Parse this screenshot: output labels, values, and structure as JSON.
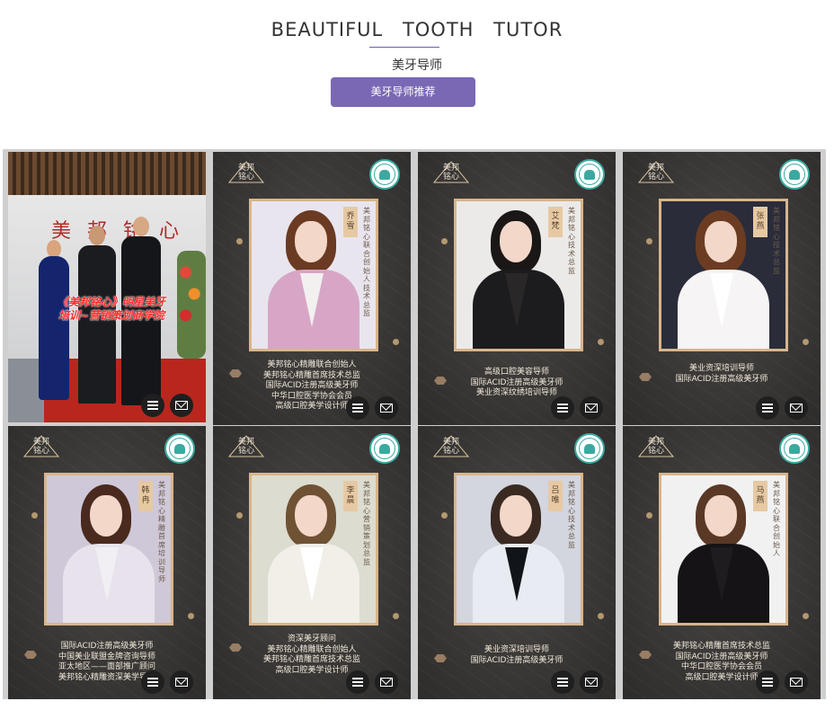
{
  "header": {
    "title_words": [
      "BEAUTIFUL",
      "TOOTH",
      "TUTOR"
    ],
    "subtitle": "美牙导师",
    "tab_label": "美牙导师推荐"
  },
  "brand": {
    "logo_text": "美邦铭心",
    "accent": "#7a68b5",
    "frame_gold": "#d8b58c",
    "card_dark": "#3a3836"
  },
  "photo_card": {
    "sign_text": "美邦铭心",
    "overlay_lines": [
      "《美邦铭心》明星美牙",
      "培训~营销策划商学院"
    ]
  },
  "tutors": [
    {
      "name": "乔雪",
      "title_vertical": "美邦铭心联合创始人技术总监",
      "lines": [
        "美邦铭心精雕联合创始人",
        "美邦铭心精雕首席技术总监",
        "国际ACID注册高级美牙师",
        "中华口腔医学协会会员",
        "高级口腔美学设计师"
      ]
    },
    {
      "name": "艾梵",
      "title_vertical": "美邦铭心技术总监",
      "lines": [
        "高级口腔美容导师",
        "国际ACID注册高级美牙师",
        "美业资深纹绣培训导师"
      ]
    },
    {
      "name": "张燕",
      "title_vertical": "美邦铭心技术总监",
      "lines": [
        "美业资深培训导师",
        "国际ACID注册高级美牙师"
      ]
    },
    {
      "name": "韩冉",
      "title_vertical": "美邦铭心精雕首席培训导师",
      "lines": [
        "国际ACID注册高级美牙师",
        "中国美业联盟金牌咨询导师",
        "亚太地区——面部推广顾问",
        "美邦铭心精雕资深美学导师"
      ]
    },
    {
      "name": "李晨",
      "title_vertical": "美邦铭心营销策划总监",
      "lines": [
        "资深美牙顾问",
        "美邦铭心精雕联合创始人",
        "美邦铭心精雕首席技术总监",
        "高级口腔美学设计师"
      ]
    },
    {
      "name": "吕唯",
      "title_vertical": "美邦铭心技术总监",
      "lines": [
        "美业资深培训导师",
        "国际ACID注册高级美牙师"
      ]
    },
    {
      "name": "马燕",
      "title_vertical": "美邦铭心联合创始人",
      "lines": [
        "美邦铭心精雕首席技术总监",
        "国际ACID注册高级美牙师",
        "中华口腔医学协会会员",
        "高级口腔美学设计师"
      ]
    }
  ],
  "icons": {
    "list": "list-icon",
    "mail": "mail-icon",
    "badge": "tooth-badge-icon"
  }
}
